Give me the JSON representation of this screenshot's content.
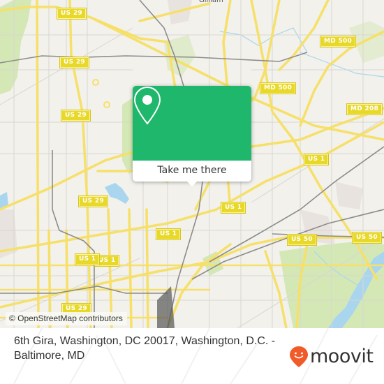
{
  "map": {
    "place_labels": [
      {
        "text": "Gilliam"
      }
    ],
    "route_shields": [
      {
        "text": "US 29"
      },
      {
        "text": "US 29"
      },
      {
        "text": "US 29"
      },
      {
        "text": "US 29"
      },
      {
        "text": "US 29"
      },
      {
        "text": "US 1"
      },
      {
        "text": "US 1"
      },
      {
        "text": "US 1"
      },
      {
        "text": "US 1"
      },
      {
        "text": "US 1"
      },
      {
        "text": "US 50"
      },
      {
        "text": "US 50"
      },
      {
        "text": "MD 500"
      },
      {
        "text": "MD 500"
      },
      {
        "text": "MD 208"
      }
    ],
    "attribution": "© OpenStreetMap contributors",
    "colors": {
      "land": "#f2f1ec",
      "park": "#d4e8b6",
      "water": "#a9d6ee",
      "road_major": "#f6e06a",
      "road_minor": "#d8d6d0",
      "rail": "#8c8c8c"
    }
  },
  "popup": {
    "icon": "map-pin-icon",
    "button_label": "Take me there",
    "accent_color": "#1eb76b"
  },
  "footer": {
    "address": "6th Gira, Washington, DC 20017, Washington, D.C. - Baltimore, MD",
    "brand": {
      "name": "moovit",
      "icon": "moovit-smile-pin-icon",
      "color": "#f15a29"
    }
  }
}
